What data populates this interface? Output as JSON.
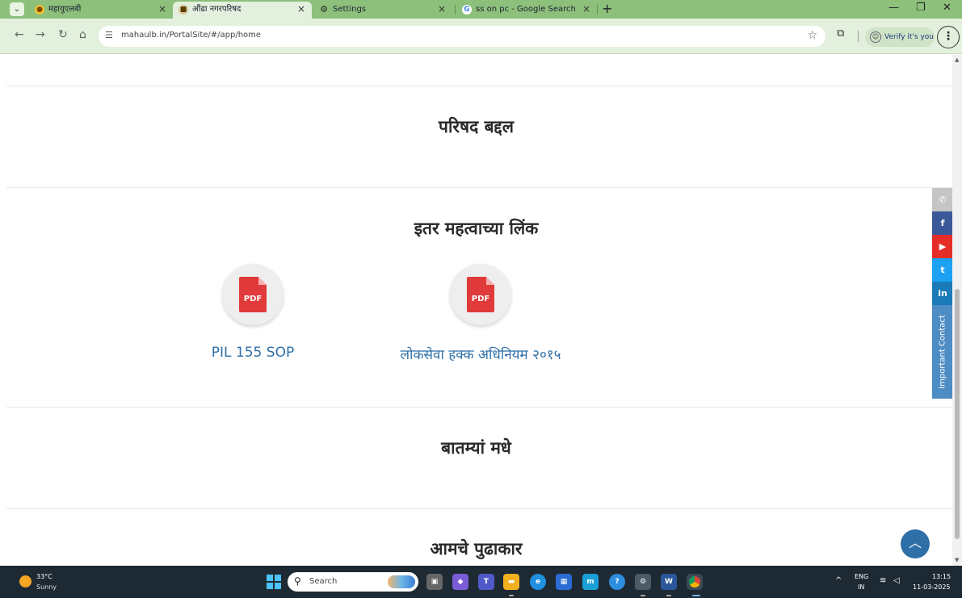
{
  "browser": {
    "tabs": [
      {
        "title": "महायुएलबी",
        "active": false
      },
      {
        "title": "औंढा नगरपरिषद",
        "active": true
      },
      {
        "title": "Settings",
        "active": false
      },
      {
        "title": "ss on pc - Google Search",
        "active": false
      }
    ],
    "tab_close": "×",
    "new_tab": "+",
    "url": "mahaulb.in/PortalSite/#/app/home",
    "verify_label": "Verify it's you"
  },
  "page": {
    "sections": [
      {
        "title": "परिषद बद्दल"
      },
      {
        "title": "इतर महत्वाच्या लिंक"
      },
      {
        "title": "बातम्यां मधे"
      },
      {
        "title": "आमचे पुढाकार"
      }
    ],
    "links": [
      {
        "label": "PIL 155 SOP",
        "icon_text": "PDF"
      },
      {
        "label": "लोकसेवा हक्क अधिनियम २०१५",
        "icon_text": "PDF"
      }
    ],
    "social": [
      {
        "icon": "phone-icon",
        "glyph": "✆",
        "color": "#c5c5c5"
      },
      {
        "icon": "facebook-icon",
        "glyph": "f",
        "color": "#3b5998"
      },
      {
        "icon": "youtube-icon",
        "glyph": "▶",
        "color": "#e52d27"
      },
      {
        "icon": "twitter-icon",
        "glyph": "t",
        "color": "#1da1f2"
      },
      {
        "icon": "linkedin-icon",
        "glyph": "in",
        "color": "#1b7bb8"
      }
    ],
    "important_contact": "Important Contact"
  },
  "taskbar": {
    "weather_temp": "33°C",
    "weather_condition": "Sunny",
    "search_placeholder": "Search",
    "language": "ENG",
    "region": "IN",
    "time": "13:15",
    "date": "11-03-2025"
  }
}
